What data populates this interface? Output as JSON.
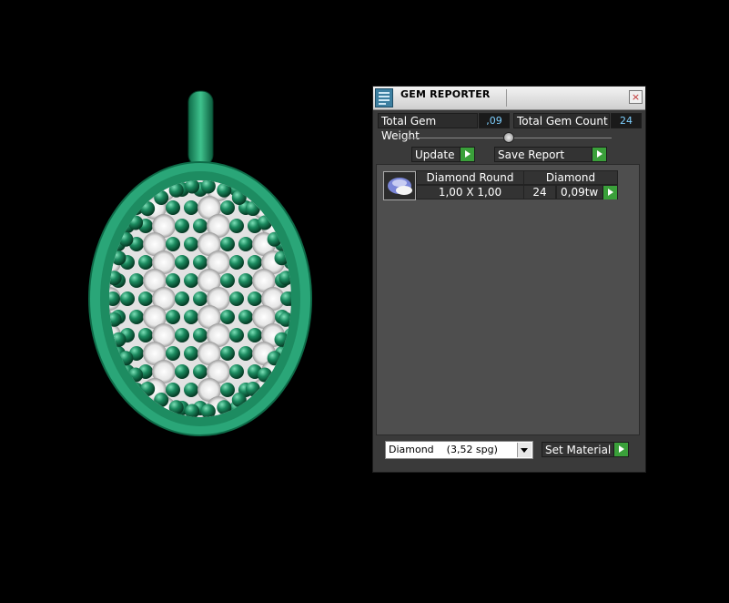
{
  "window": {
    "title": "GEM REPORTER",
    "close_glyph": "×"
  },
  "stats": {
    "total_weight_label": "Total Gem Weight",
    "total_weight_value": ",09",
    "total_count_label": "Total Gem Count",
    "total_count_value": "24"
  },
  "toolbar": {
    "update_label": "Update",
    "save_report_label": "Save Report"
  },
  "gem_list": {
    "rows": [
      {
        "shape": "Diamond Round",
        "material": "Diamond",
        "size": "1,00 X 1,00",
        "count": "24",
        "weight": "0,09tw"
      }
    ]
  },
  "footer": {
    "material_selected": "Diamond    (3,52 spg)",
    "set_material_label": "Set Material"
  },
  "colors": {
    "metal": "#1f9a6e",
    "accent_green": "#3aa03a",
    "value_text": "#7fd0ff"
  }
}
